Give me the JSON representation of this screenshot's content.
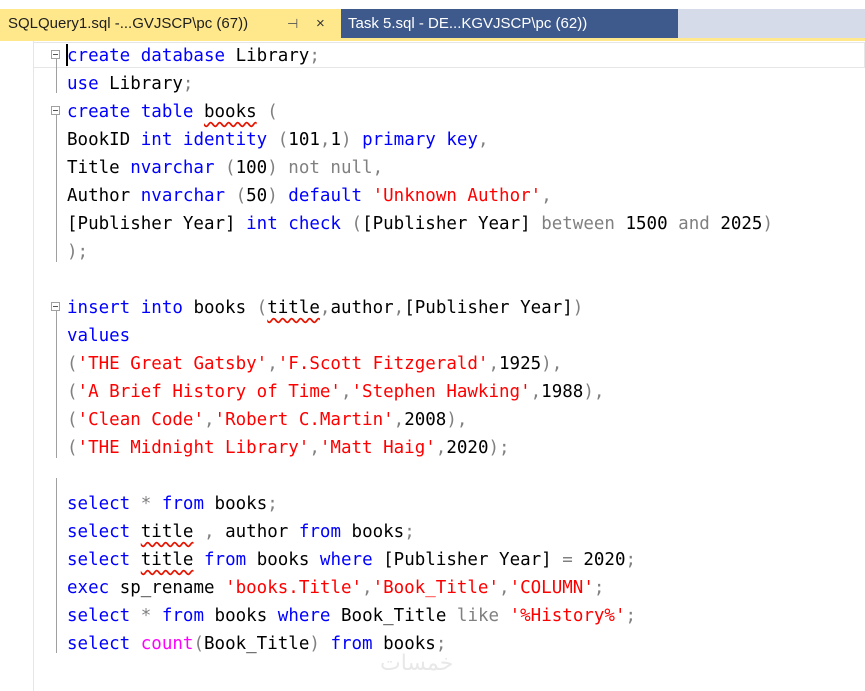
{
  "tabs": [
    {
      "label": "SQLQuery1.sql -...GVJSCP\\pc (67))",
      "active": true,
      "pin_icon": "⊣",
      "close_icon": "×"
    },
    {
      "label": "Task 5.sql - DE...KGVJSCP\\pc (62))",
      "active": false
    }
  ],
  "colors": {
    "keyword": "#0000ff",
    "string": "#ff0000",
    "operator": "#808080",
    "function": "#ff00ff",
    "active_tab": "#ffe88c",
    "inactive_tab": "#3e5a8c"
  },
  "code": {
    "l1": [
      "create database",
      " Library",
      ";"
    ],
    "l2": [
      "use",
      " Library",
      ";"
    ],
    "l3": [
      "create table",
      " ",
      "books",
      " ("
    ],
    "l4": [
      "BookID ",
      "int identity",
      " (",
      "101",
      ",",
      "1",
      ") ",
      "primary key",
      ","
    ],
    "l5": [
      "Title ",
      "nvarchar",
      " (",
      "100",
      ") ",
      "not null",
      ","
    ],
    "l6": [
      "Author ",
      "nvarchar",
      " (",
      "50",
      ") ",
      "default",
      " ",
      "'Unknown Author'",
      ","
    ],
    "l7": [
      "[Publisher Year] ",
      "int",
      " ",
      "check",
      " ",
      "(",
      "[Publisher Year] ",
      "between",
      " 1500 ",
      "and",
      " 2025",
      ")"
    ],
    "l8": [
      ");"
    ],
    "l10": [
      "insert into",
      " books ",
      "(",
      "title",
      ",",
      "author",
      ",",
      "[Publisher Year]",
      ")"
    ],
    "l11": [
      "values"
    ],
    "l12": [
      "(",
      "'THE Great Gatsby'",
      ",",
      "'F.Scott Fitzgerald'",
      ",",
      "1925",
      "),"
    ],
    "l13": [
      "(",
      "'A Brief History of Time'",
      ",",
      "'Stephen Hawking'",
      ",",
      "1988",
      "),"
    ],
    "l14": [
      "(",
      "'Clean Code'",
      ",",
      "'Robert C.Martin'",
      ",",
      "2008",
      "),"
    ],
    "l15": [
      "(",
      "'THE Midnight Library'",
      ",",
      "'Matt Haig'",
      ",",
      "2020",
      ");"
    ],
    "l17": [
      "select",
      " ",
      "*",
      " ",
      "from",
      " books",
      ";"
    ],
    "l18": [
      "select",
      " ",
      "title",
      " ",
      ",",
      " author ",
      "from",
      " books",
      ";"
    ],
    "l19": [
      "select",
      " ",
      "title",
      " ",
      "from",
      " books ",
      "where",
      " [Publisher Year] ",
      "=",
      " 2020",
      ";"
    ],
    "l20": [
      "exec",
      " sp_rename ",
      "'books.Title'",
      ",",
      "'Book_Title'",
      ",",
      "'COLUMN'",
      ";"
    ],
    "l21": [
      "select",
      " ",
      "*",
      " ",
      "from",
      " books ",
      "where",
      " Book_Title ",
      "like",
      " ",
      "'%History%'",
      ";"
    ],
    "l22": [
      "select",
      " ",
      "count",
      "(",
      "Book_Title",
      ") ",
      "from",
      " books",
      ";"
    ]
  },
  "watermark": "خمسات"
}
